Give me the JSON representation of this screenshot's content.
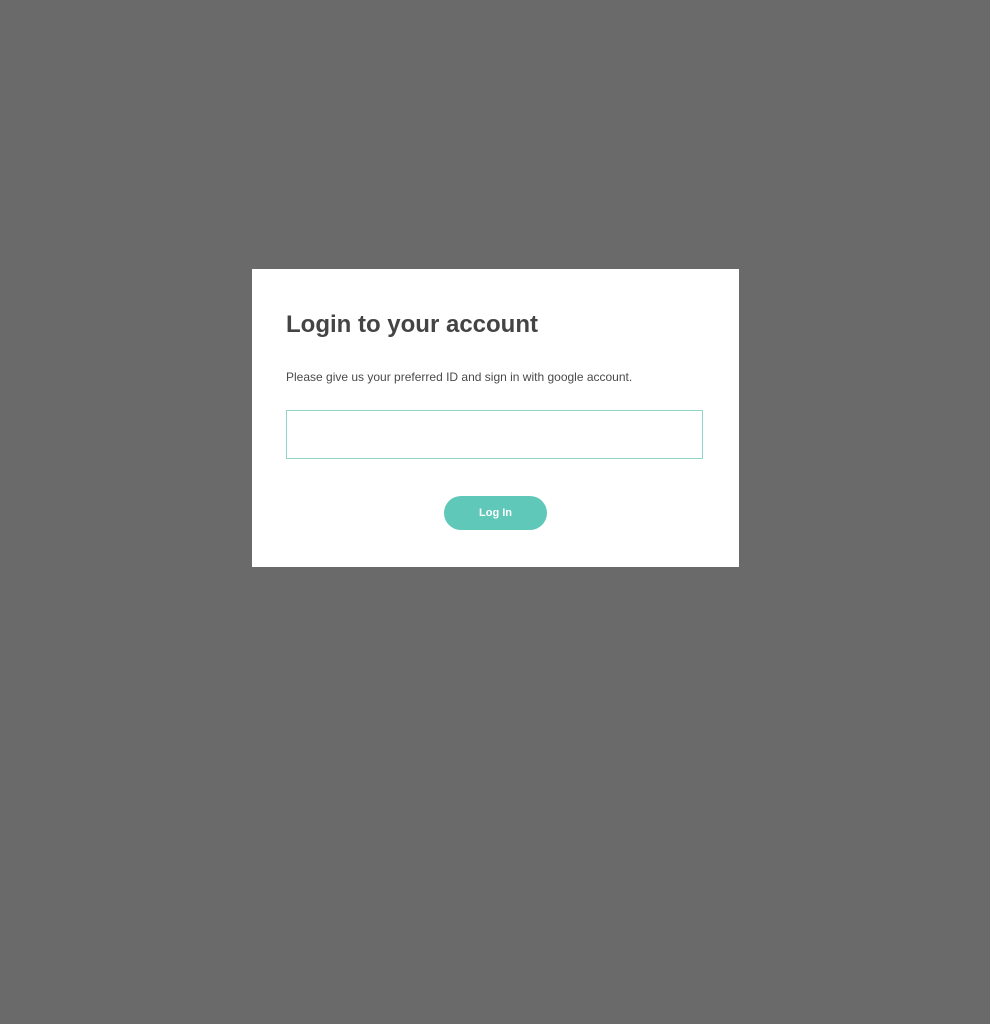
{
  "login_modal": {
    "title": "Login to your account",
    "description": "Please give us your preferred ID and sign in with google account.",
    "id_input": {
      "value": "",
      "placeholder": ""
    },
    "login_button_label": "Log In"
  },
  "colors": {
    "overlay": "#6a6a6a",
    "accent": "#5fc8b8",
    "input_border": "#8fd6c8",
    "heading_text": "#444444"
  }
}
